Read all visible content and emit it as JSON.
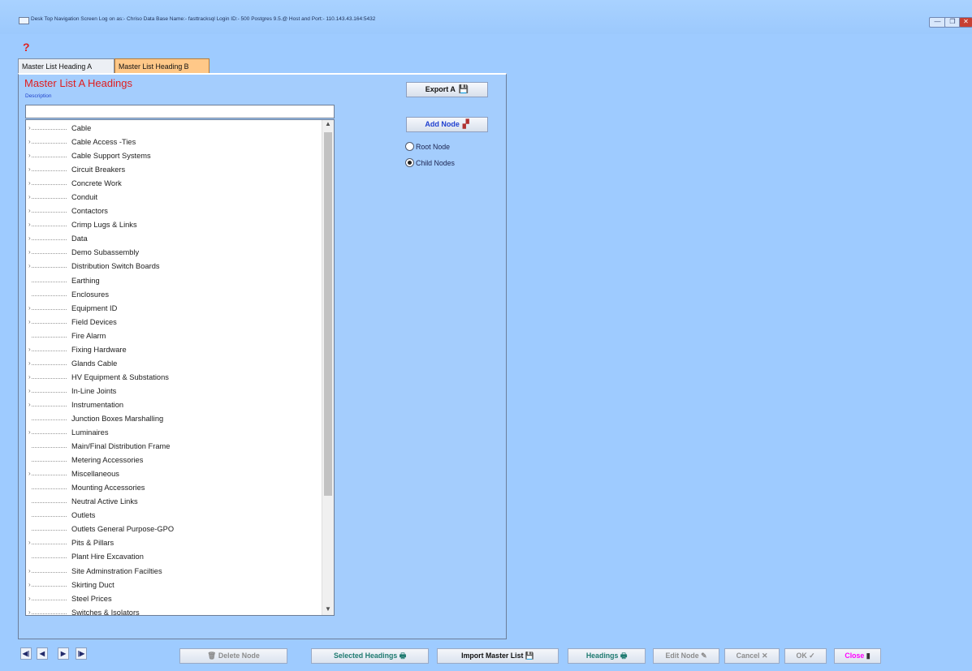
{
  "window": {
    "title": "Desk Top Navigation Screen Log on as:- Chriso  Data Base Name:- fasttracksql Login ID:- 500 Postgres 9.5.@  Host and Port:- 110.143.43.164:5432",
    "minimize": "—",
    "restore": "❐",
    "close": "✕",
    "help": "?"
  },
  "tabs": [
    {
      "label": "Master List Heading A",
      "active": true
    },
    {
      "label": "Master List Heading B",
      "active": false
    }
  ],
  "panel": {
    "title": "Master List A Headings",
    "description_label": "Description",
    "description_value": ""
  },
  "tree_items": [
    {
      "label": "Cable",
      "expandable": true
    },
    {
      "label": "Cable  Access -Ties",
      "expandable": true
    },
    {
      "label": "Cable Support Systems",
      "expandable": true
    },
    {
      "label": "Circuit Breakers",
      "expandable": true
    },
    {
      "label": "Concrete Work",
      "expandable": true
    },
    {
      "label": "Conduit",
      "expandable": true
    },
    {
      "label": "Contactors",
      "expandable": true
    },
    {
      "label": "Crimp Lugs & Links",
      "expandable": true
    },
    {
      "label": "Data",
      "expandable": true
    },
    {
      "label": "Demo Subassembly",
      "expandable": true
    },
    {
      "label": "Distribution Switch Boards",
      "expandable": true
    },
    {
      "label": "Earthing",
      "expandable": false
    },
    {
      "label": "Enclosures",
      "expandable": false
    },
    {
      "label": "Equipment ID",
      "expandable": true
    },
    {
      "label": "Field Devices",
      "expandable": true
    },
    {
      "label": "Fire Alarm",
      "expandable": false
    },
    {
      "label": "Fixing Hardware",
      "expandable": true
    },
    {
      "label": "Glands Cable",
      "expandable": true
    },
    {
      "label": "HV Equipment & Substations",
      "expandable": true
    },
    {
      "label": "In-Line Joints",
      "expandable": true
    },
    {
      "label": "Instrumentation",
      "expandable": true
    },
    {
      "label": "Junction Boxes Marshalling",
      "expandable": false
    },
    {
      "label": "Luminaires",
      "expandable": true
    },
    {
      "label": "Main/Final Distribution Frame",
      "expandable": false
    },
    {
      "label": "Metering Accessories",
      "expandable": false
    },
    {
      "label": "Miscellaneous",
      "expandable": true
    },
    {
      "label": "Mounting Accessories",
      "expandable": false
    },
    {
      "label": "Neutral Active Links",
      "expandable": false
    },
    {
      "label": "Outlets",
      "expandable": false
    },
    {
      "label": "Outlets General Purpose-GPO",
      "expandable": false
    },
    {
      "label": "Pits & Pillars",
      "expandable": true
    },
    {
      "label": "Plant Hire Excavation",
      "expandable": false
    },
    {
      "label": "Site Adminstration Facilties",
      "expandable": true
    },
    {
      "label": "Skirting Duct",
      "expandable": true
    },
    {
      "label": "Steel Prices",
      "expandable": true
    },
    {
      "label": "Switches & Isolators",
      "expandable": true
    }
  ],
  "buttons": {
    "export_a": "Export A",
    "add_node": "Add Node"
  },
  "radios": [
    {
      "label": "Root Node",
      "checked": false
    },
    {
      "label": "Child Nodes",
      "checked": true
    }
  ],
  "nav": {
    "first": "◀|",
    "prev": "◀",
    "next": "▶",
    "last": "|▶"
  },
  "bottom_buttons": {
    "delete_node": "Delete Node",
    "selected_headings": "Selected Headings",
    "import_master_list": "Import Master List",
    "headings": "Headings",
    "edit_node": "Edit Node",
    "cancel": "Cancel",
    "ok": "OK",
    "close": "Close"
  },
  "colors": {
    "background": "#9ecbff",
    "title_red": "#e01e1e",
    "tab_b_orange": "#ffc888",
    "teal_button_text": "#1e7a70",
    "close_magenta": "#ff00ff"
  }
}
